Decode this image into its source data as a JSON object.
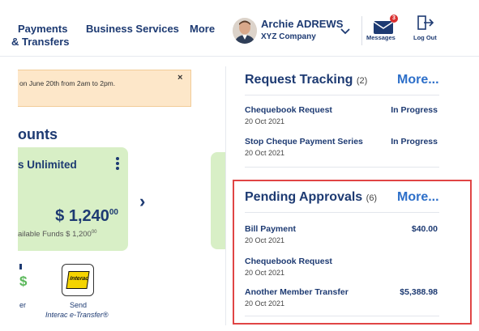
{
  "header": {
    "nav": {
      "payments_line1": "Payments",
      "payments_line2": "& Transfers",
      "business_services": "Business Services",
      "more": "More"
    },
    "user": {
      "name": "Archie ADREWS",
      "company": "XYZ Company"
    },
    "messages": {
      "label": "Messages",
      "badge": "3"
    },
    "logout": {
      "label": "Log Out"
    }
  },
  "banner": {
    "text": "on June 20th from 2am to 2pm.",
    "close": "×"
  },
  "accounts": {
    "title": "ounts",
    "card": {
      "name": "s Unlimited",
      "balance": "$ 1,240",
      "balance_cents": "00",
      "funds": "ailable Funds $ 1,200",
      "funds_cents": "00"
    },
    "next_arrow": "›"
  },
  "quick_actions": {
    "send_line1": "Send",
    "send_line2": "Interac e-Transfer®",
    "interac_logo": "Interac",
    "partial_label": "er"
  },
  "request_tracking": {
    "title": "Request Tracking",
    "count": "(2)",
    "more": "More...",
    "items": [
      {
        "title": "Chequebook Request",
        "date": "20 Oct 2021",
        "status": "In Progress"
      },
      {
        "title": "Stop Cheque Payment Series",
        "date": "20 Oct 2021",
        "status": "In Progress"
      }
    ]
  },
  "pending_approvals": {
    "title": "Pending Approvals",
    "count": "(6)",
    "more": "More...",
    "items": [
      {
        "title": "Bill Payment",
        "date": "20 Oct 2021",
        "amount": "$40.00"
      },
      {
        "title": "Chequebook Request",
        "date": "20 Oct 2021",
        "amount": ""
      },
      {
        "title": "Another Member Transfer",
        "date": "20 Oct 2021",
        "amount": "$5,388.98"
      }
    ]
  },
  "colors": {
    "brand_navy": "#1d3a72",
    "link_blue": "#2d6fc9",
    "banner_bg": "#fde7c9",
    "card_green": "#d8efc6",
    "highlight_red": "#e04545"
  }
}
